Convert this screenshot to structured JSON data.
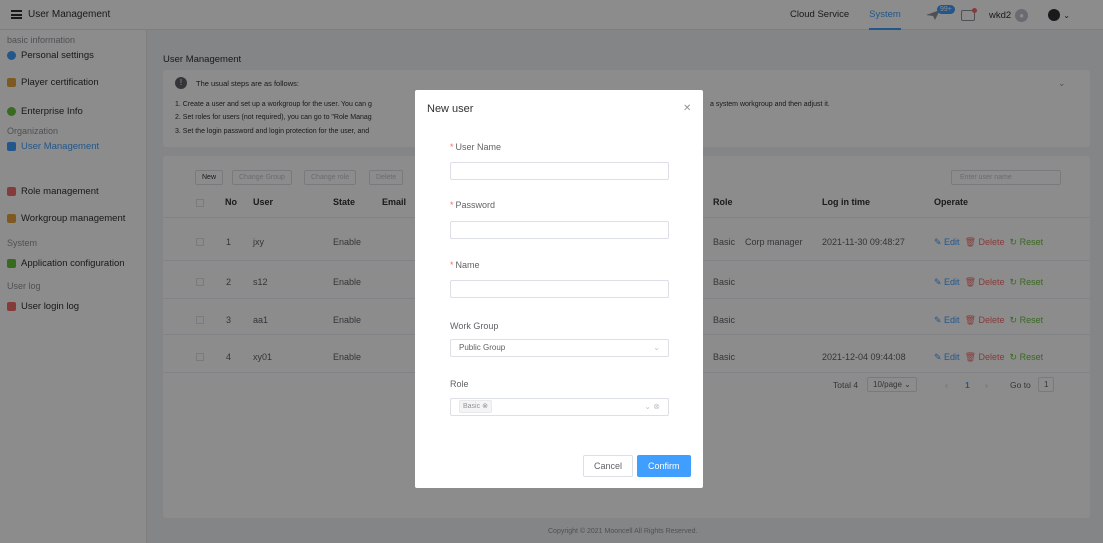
{
  "app": {
    "title": "User Management"
  },
  "topnav": {
    "items": [
      "Cloud Service",
      "System"
    ],
    "badge": "99+",
    "username": "wkd2"
  },
  "sidebar": {
    "g1": "basic information",
    "personal": "Personal settings",
    "player": "Player certification",
    "enterprise": "Enterprise Info",
    "g2": "Organization",
    "usermgmt": "User Management",
    "role": "Role management",
    "workgroup": "Workgroup management",
    "g3": "System",
    "appconfig": "Application configuration",
    "g4": "User log",
    "loginlog": "User login log"
  },
  "breadcrumb": "User Management",
  "tip": {
    "title": "The usual steps are as follows:",
    "s1": "1. Create a user and set up a workgroup for the user. You can g",
    "s1b": "a system workgroup and then adjust it.",
    "s2": "2. Set roles for users (not required), you can go to \"Role Manag",
    "s3": "3. Set the login password and login protection for the user, and"
  },
  "toolbar": {
    "new": "New",
    "change_group": "Change Group",
    "change_role": "Change role",
    "delete": "Delete",
    "search_placeholder": "Enter user name"
  },
  "table": {
    "headers": {
      "no": "No",
      "user": "User",
      "state": "State",
      "email": "Email",
      "role": "Role",
      "login": "Log in time",
      "operate": "Operate"
    },
    "rows": [
      {
        "no": "1",
        "user": "jxy",
        "state": "Enable",
        "role": "Basic",
        "role2": "Corp manager",
        "login": "2021-11-30 09:48:27"
      },
      {
        "no": "2",
        "user": "s12",
        "state": "Enable",
        "role": "Basic",
        "role2": "",
        "login": ""
      },
      {
        "no": "3",
        "user": "aa1",
        "state": "Enable",
        "role": "Basic",
        "role2": "",
        "login": ""
      },
      {
        "no": "4",
        "user": "xy01",
        "state": "Enable",
        "role": "Basic",
        "role2": "",
        "login": "2021-12-04 09:44:08"
      }
    ],
    "ops": {
      "edit": "Edit",
      "delete": "Delete",
      "reset": "Reset"
    }
  },
  "pagination": {
    "total": "Total 4",
    "size": "10/page",
    "page": "1",
    "goto": "Go to",
    "goto_val": "1"
  },
  "footer": "Copyright © 2021 Mooncell All Rights Reserved.",
  "modal": {
    "title": "New user",
    "username_label": "User Name",
    "password_label": "Password",
    "name_label": "Name",
    "workgroup_label": "Work Group",
    "workgroup_value": "Public Group",
    "role_label": "Role",
    "role_tag": "Basic",
    "cancel": "Cancel",
    "confirm": "Confirm"
  },
  "colors": {
    "primary": "#409eff",
    "danger": "#f56c6c",
    "success": "#67c23a"
  }
}
